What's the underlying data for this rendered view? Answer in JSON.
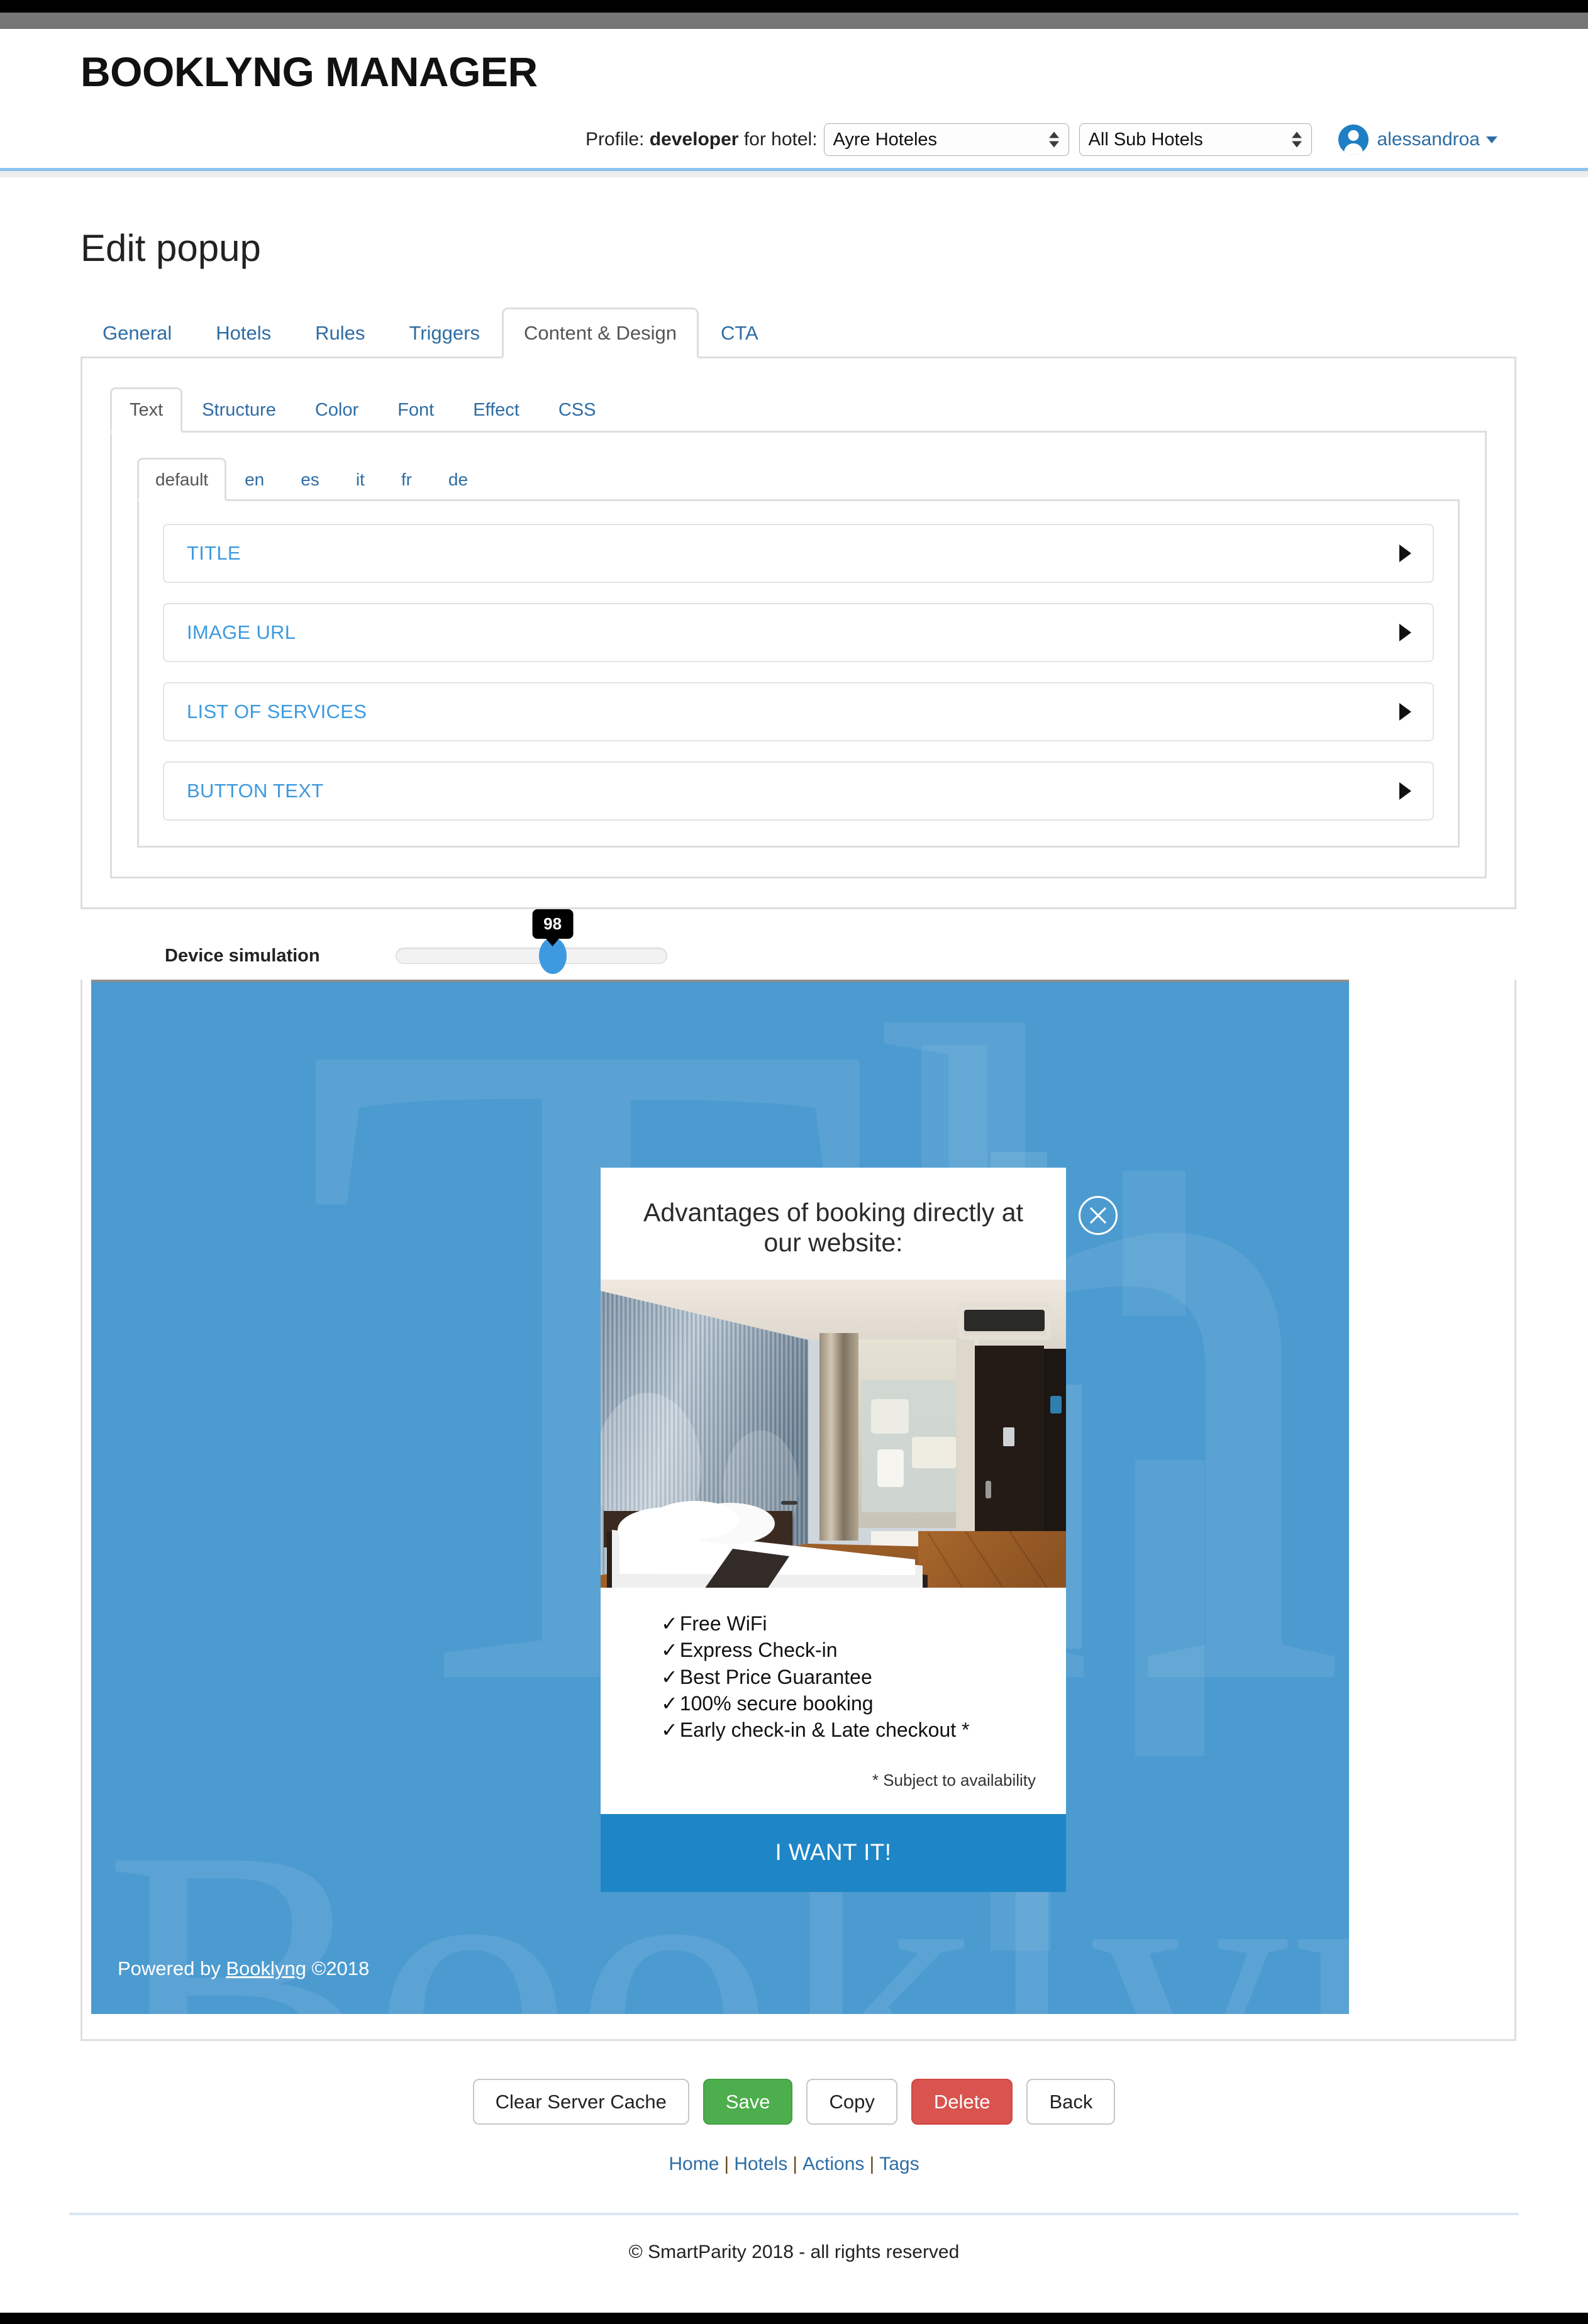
{
  "browser": {
    "chrome_top": "",
    "chrome_bottom": ""
  },
  "brand": {
    "title": "BOOKLYNG MANAGER"
  },
  "profilebar": {
    "prefix": "Profile:",
    "profile_name": "developer",
    "middle": "for hotel:",
    "hotel_select": {
      "value": "Ayre Hoteles"
    },
    "subhotel_select": {
      "value": "All Sub Hotels"
    },
    "user": {
      "name": "alessandroa",
      "avatar_icon": "user-avatar-icon",
      "caret_icon": "chevron-down-icon"
    }
  },
  "page": {
    "title": "Edit popup"
  },
  "tabs_outer": [
    {
      "label": "General",
      "active": false
    },
    {
      "label": "Hotels",
      "active": false
    },
    {
      "label": "Rules",
      "active": false
    },
    {
      "label": "Triggers",
      "active": false
    },
    {
      "label": "Content & Design",
      "active": true
    },
    {
      "label": "CTA",
      "active": false
    }
  ],
  "tabs_inner": [
    {
      "label": "Text",
      "active": true
    },
    {
      "label": "Structure",
      "active": false
    },
    {
      "label": "Color",
      "active": false
    },
    {
      "label": "Font",
      "active": false
    },
    {
      "label": "Effect",
      "active": false
    },
    {
      "label": "CSS",
      "active": false
    }
  ],
  "tabs_lang": [
    {
      "label": "default",
      "active": true
    },
    {
      "label": "en",
      "active": false
    },
    {
      "label": "es",
      "active": false
    },
    {
      "label": "it",
      "active": false
    },
    {
      "label": "fr",
      "active": false
    },
    {
      "label": "de",
      "active": false
    }
  ],
  "accordion": [
    {
      "label": "TITLE",
      "caret_icon": "caret-right-icon"
    },
    {
      "label": "IMAGE URL",
      "caret_icon": "caret-right-icon"
    },
    {
      "label": "LIST OF SERVICES",
      "caret_icon": "caret-right-icon"
    },
    {
      "label": "BUTTON TEXT",
      "caret_icon": "caret-right-icon"
    }
  ],
  "device_simulation": {
    "label": "Device simulation",
    "value": "98",
    "min": "0",
    "max": "100"
  },
  "preview": {
    "background_color": "#4c9bd0",
    "watermark_top": "Th",
    "watermark_bottom": "Booklyng",
    "powered_prefix": "Powered by ",
    "powered_link": "Booklyng",
    "powered_suffix": " ©2018",
    "popup": {
      "title": "Advantages of booking directly at our website:",
      "close_icon": "close-circle-icon",
      "image_alt": "hotel-room-photo",
      "services": [
        "Free WiFi",
        "Express Check-in",
        "Best Price Guarantee",
        "100% secure booking",
        "Early check-in & Late checkout *"
      ],
      "check_glyph": "✓",
      "note": "* Subject to availability",
      "cta_label": "I WANT IT!",
      "cta_color": "#1e86c6"
    }
  },
  "actions": [
    {
      "label": "Clear Server Cache",
      "style": "default"
    },
    {
      "label": "Save",
      "style": "green"
    },
    {
      "label": "Copy",
      "style": "default"
    },
    {
      "label": "Delete",
      "style": "red"
    },
    {
      "label": "Back",
      "style": "default"
    }
  ],
  "footer": {
    "links": [
      "Home",
      "Hotels",
      "Actions",
      "Tags"
    ],
    "separator": "|",
    "copyright": "© SmartParity 2018 - all rights reserved"
  },
  "colors": {
    "accent_blue": "#2e6da4",
    "link_blue": "#3d9ae0",
    "preview_blue": "#4c9bd0",
    "cta_blue": "#1e86c6",
    "green": "#4cae4c",
    "red": "#d9534f",
    "chrome_gray": "#757575"
  }
}
